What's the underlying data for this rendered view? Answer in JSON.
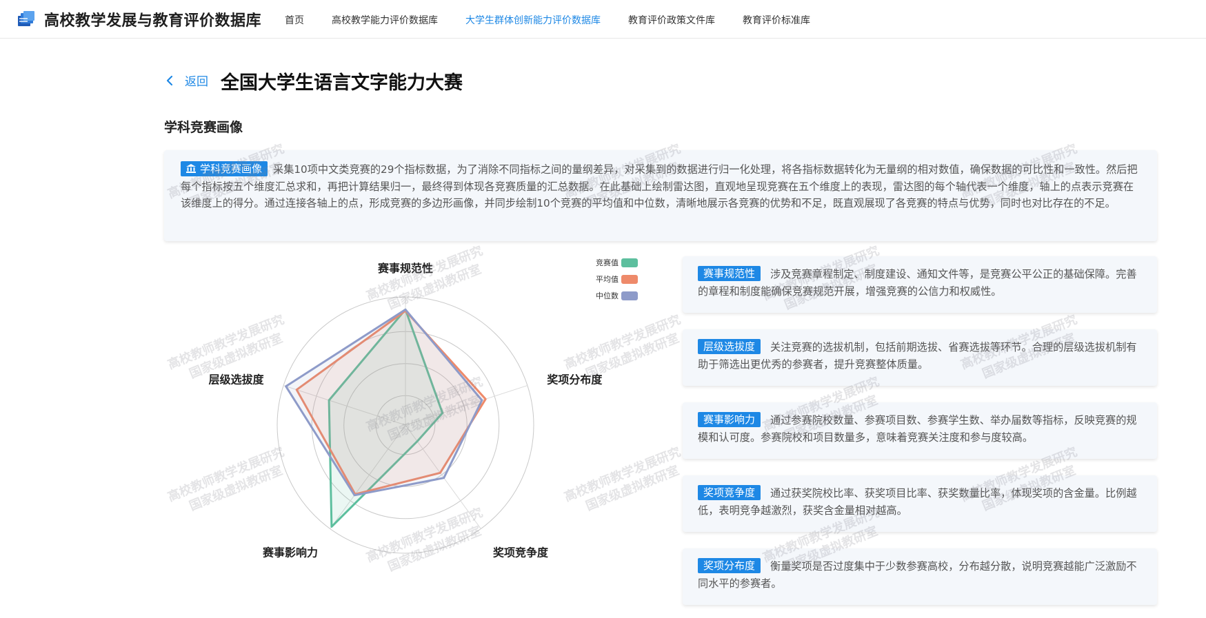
{
  "brand": {
    "title": "高校教学发展与教育评价数据库",
    "logo": "book-stack-icon"
  },
  "nav": {
    "items": [
      {
        "label": "首页",
        "active": false
      },
      {
        "label": "高校教学能力评价数据库",
        "active": false
      },
      {
        "label": "大学生群体创新能力评价数据库",
        "active": true
      },
      {
        "label": "教育评价政策文件库",
        "active": false
      },
      {
        "label": "教育评价标准库",
        "active": false
      }
    ]
  },
  "page": {
    "back_label": "返回",
    "title": "全国大学生语言文字能力大赛",
    "section_title": "学科竞赛画像"
  },
  "intro": {
    "tag": "学科竞赛画像",
    "tag_icon": "bank-icon",
    "text": "采集10项中文类竞赛的29个指标数据，为了消除不同指标之间的量纲差异，对采集到的数据进行归一化处理，将各指标数据转化为无量纲的相对数值，确保数据的可比性和一致性。然后把每个指标按五个维度汇总求和，再把计算结果归一，最终得到体现各竞赛质量的汇总数据。在此基础上绘制雷达图，直观地呈现竞赛在五个维度上的表现，雷达图的每个轴代表一个维度，轴上的点表示竞赛在该维度上的得分。通过连接各轴上的点，形成竞赛的多边形画像，并同步绘制10个竞赛的平均值和中位数，清晰地展示各竞赛的优势和不足，既直观展现了各竞赛的特点与优势，同时也对比存在的不足。"
  },
  "chart_data": {
    "type": "radar",
    "axes": [
      "赛事规范性",
      "奖项分布度",
      "奖项竞争度",
      "赛事影响力",
      "层级选拔度"
    ],
    "rmax": 1,
    "rings": 3,
    "series": [
      {
        "name": "竞赛值",
        "color": "#5dbf9e",
        "values": [
          0.92,
          0.31,
          0.16,
          1.0,
          0.64
        ]
      },
      {
        "name": "平均值",
        "color": "#ee8a6a",
        "values": [
          0.91,
          0.67,
          0.47,
          0.68,
          0.91
        ]
      },
      {
        "name": "中位数",
        "color": "#8e9bc9",
        "values": [
          0.92,
          0.64,
          0.52,
          0.69,
          1.0
        ]
      }
    ]
  },
  "cards": [
    {
      "tag": "赛事规范性",
      "text": "涉及竞赛章程制定、制度建设、通知文件等，是竞赛公平公正的基础保障。完善的章程和制度能确保竞赛规范开展，增强竞赛的公信力和权威性。"
    },
    {
      "tag": "层级选拔度",
      "text": "关注竞赛的选拔机制，包括前期选拔、省赛选拔等环节。合理的层级选拔机制有助于筛选出更优秀的参赛者，提升竞赛整体质量。"
    },
    {
      "tag": "赛事影响力",
      "text": "通过参赛院校数量、参赛项目数、参赛学生数、举办届数等指标，反映竞赛的规模和认可度。参赛院校和项目数量多，意味着竞赛关注度和参与度较高。"
    },
    {
      "tag": "奖项竞争度",
      "text": "通过获奖院校比率、获奖项目比率、获奖数量比率，体现奖项的含金量。比例越低，表明竞争越激烈，获奖含金量相对越高。"
    },
    {
      "tag": "奖项分布度",
      "text": "衡量奖项是否过度集中于少数参赛高校，分布越分散，说明竞赛越能广泛激励不同水平的参赛者。"
    }
  ],
  "watermark": {
    "line1": "高校教师教学发展研究",
    "line2": "国家级虚拟教研室"
  }
}
